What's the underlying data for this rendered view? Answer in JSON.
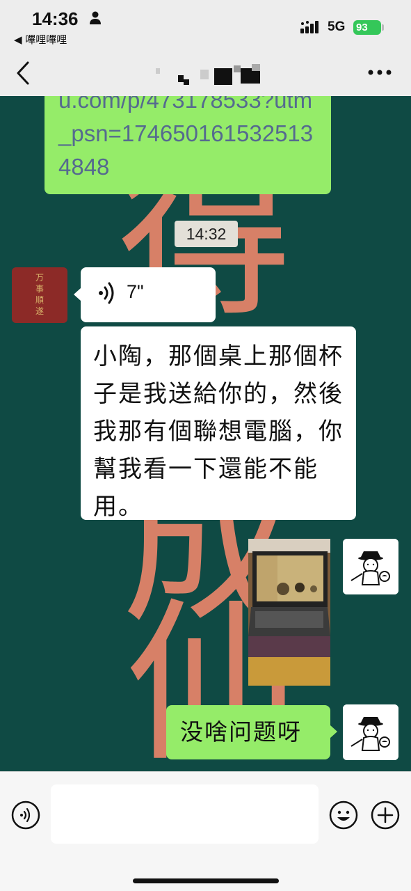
{
  "status_bar": {
    "time": "14:36",
    "back_app": "◀ 嗶哩嗶哩",
    "network": "5G",
    "battery": "93"
  },
  "chat": {
    "link_text": "u.com/p/473178533?utm_psn=1746501615325134848",
    "timestamp": "14:32",
    "voice_duration": "7\"",
    "message_text": "小陶，那個桌上那個杯子是我送給你的，然後我那有個聯想電腦，你幫我看一下還能不能用。",
    "reply_text": "没啥问题呀",
    "avatar_left_text": [
      "万",
      "事",
      "順",
      "遂"
    ]
  },
  "colors": {
    "wallpaper": "#0f4a44",
    "calligraphy": "#e8856b",
    "self_bubble": "#95ec69",
    "link_text": "#556a8f",
    "battery_green": "#34c759"
  }
}
